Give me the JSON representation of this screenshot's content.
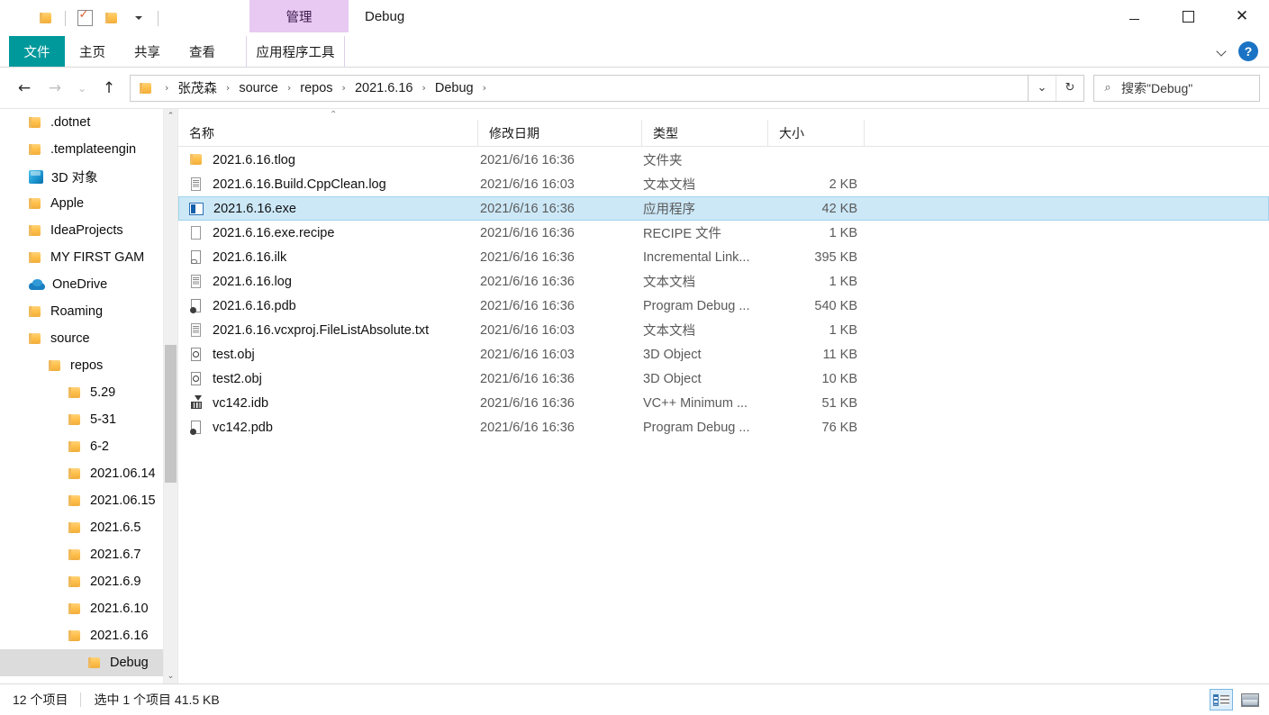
{
  "window": {
    "title": "Debug",
    "contextual_tab": "管理",
    "controls": {
      "minimize": "—",
      "maximize": "□",
      "close": "✕"
    }
  },
  "quick_access": {
    "items": [
      {
        "name": "folder-icon",
        "label": ""
      },
      {
        "name": "properties-icon",
        "label": ""
      },
      {
        "name": "new-folder-icon",
        "label": ""
      },
      {
        "name": "customize-dropdown-icon",
        "label": ""
      }
    ]
  },
  "ribbon": {
    "tabs": [
      {
        "id": "file",
        "label": "文件"
      },
      {
        "id": "home",
        "label": "主页"
      },
      {
        "id": "share",
        "label": "共享"
      },
      {
        "id": "view",
        "label": "查看"
      },
      {
        "id": "apptools",
        "label": "应用程序工具"
      }
    ],
    "expand_label": "",
    "help_label": "?"
  },
  "address": {
    "back": "←",
    "forward": "→",
    "recent": "⌄",
    "up": "↑",
    "crumbs": [
      "张茂森",
      "source",
      "repos",
      "2021.6.16",
      "Debug"
    ],
    "separator": "›",
    "dropdown": "⌄",
    "refresh": "↻"
  },
  "search": {
    "placeholder": "搜索\"Debug\"",
    "value": "",
    "icon": "search-icon"
  },
  "sidebar": {
    "items": [
      {
        "label": ".dotnet",
        "icon": "folder-icon",
        "indent": 0,
        "selected": false
      },
      {
        "label": ".templateengin",
        "icon": "folder-icon",
        "indent": 0,
        "selected": false
      },
      {
        "label": "3D 对象",
        "icon": "3d-objects-icon",
        "indent": 0,
        "selected": false
      },
      {
        "label": "Apple",
        "icon": "folder-icon",
        "indent": 0,
        "selected": false
      },
      {
        "label": "IdeaProjects",
        "icon": "folder-icon",
        "indent": 0,
        "selected": false
      },
      {
        "label": "MY FIRST GAM",
        "icon": "folder-icon",
        "indent": 0,
        "selected": false
      },
      {
        "label": "OneDrive",
        "icon": "onedrive-icon",
        "indent": 0,
        "selected": false
      },
      {
        "label": "Roaming",
        "icon": "folder-icon",
        "indent": 0,
        "selected": false
      },
      {
        "label": "source",
        "icon": "folder-icon",
        "indent": 0,
        "selected": false
      },
      {
        "label": "repos",
        "icon": "folder-icon",
        "indent": 1,
        "selected": false
      },
      {
        "label": "5.29",
        "icon": "folder-icon",
        "indent": 2,
        "selected": false
      },
      {
        "label": "5-31",
        "icon": "folder-icon",
        "indent": 2,
        "selected": false
      },
      {
        "label": "6-2",
        "icon": "folder-icon",
        "indent": 2,
        "selected": false
      },
      {
        "label": "2021.06.14",
        "icon": "folder-icon",
        "indent": 2,
        "selected": false
      },
      {
        "label": "2021.06.15",
        "icon": "folder-icon",
        "indent": 2,
        "selected": false
      },
      {
        "label": "2021.6.5",
        "icon": "folder-icon",
        "indent": 2,
        "selected": false
      },
      {
        "label": "2021.6.7",
        "icon": "folder-icon",
        "indent": 2,
        "selected": false
      },
      {
        "label": "2021.6.9",
        "icon": "folder-icon",
        "indent": 2,
        "selected": false
      },
      {
        "label": "2021.6.10",
        "icon": "folder-icon",
        "indent": 2,
        "selected": false
      },
      {
        "label": "2021.6.16",
        "icon": "folder-icon",
        "indent": 2,
        "selected": false
      },
      {
        "label": "Debug",
        "icon": "folder-icon",
        "indent": 3,
        "selected": true
      }
    ],
    "scroll_up": "⌃",
    "scroll_down": "⌄"
  },
  "filelist": {
    "sort_indicator": "⌃",
    "columns": [
      {
        "id": "name",
        "label": "名称"
      },
      {
        "id": "date",
        "label": "修改日期"
      },
      {
        "id": "type",
        "label": "类型"
      },
      {
        "id": "size",
        "label": "大小"
      }
    ],
    "rows": [
      {
        "name": "2021.6.16.tlog",
        "date": "2021/6/16 16:36",
        "type": "文件夹",
        "size": "",
        "icon": "folder",
        "selected": false
      },
      {
        "name": "2021.6.16.Build.CppClean.log",
        "date": "2021/6/16 16:03",
        "type": "文本文档",
        "size": "2 KB",
        "icon": "txt",
        "selected": false
      },
      {
        "name": "2021.6.16.exe",
        "date": "2021/6/16 16:36",
        "type": "应用程序",
        "size": "42 KB",
        "icon": "exe",
        "selected": true
      },
      {
        "name": "2021.6.16.exe.recipe",
        "date": "2021/6/16 16:36",
        "type": "RECIPE 文件",
        "size": "1 KB",
        "icon": "page",
        "selected": false
      },
      {
        "name": "2021.6.16.ilk",
        "date": "2021/6/16 16:36",
        "type": "Incremental Link...",
        "size": "395 KB",
        "icon": "ilk",
        "selected": false
      },
      {
        "name": "2021.6.16.log",
        "date": "2021/6/16 16:36",
        "type": "文本文档",
        "size": "1 KB",
        "icon": "txt",
        "selected": false
      },
      {
        "name": "2021.6.16.pdb",
        "date": "2021/6/16 16:36",
        "type": "Program Debug ...",
        "size": "540 KB",
        "icon": "pdb",
        "selected": false
      },
      {
        "name": "2021.6.16.vcxproj.FileListAbsolute.txt",
        "date": "2021/6/16 16:03",
        "type": "文本文档",
        "size": "1 KB",
        "icon": "txt",
        "selected": false
      },
      {
        "name": "test.obj",
        "date": "2021/6/16 16:03",
        "type": "3D Object",
        "size": "11 KB",
        "icon": "obj",
        "selected": false
      },
      {
        "name": "test2.obj",
        "date": "2021/6/16 16:36",
        "type": "3D Object",
        "size": "10 KB",
        "icon": "obj",
        "selected": false
      },
      {
        "name": "vc142.idb",
        "date": "2021/6/16 16:36",
        "type": "VC++ Minimum ...",
        "size": "51 KB",
        "icon": "idb",
        "selected": false
      },
      {
        "name": "vc142.pdb",
        "date": "2021/6/16 16:36",
        "type": "Program Debug ...",
        "size": "76 KB",
        "icon": "pdb",
        "selected": false
      }
    ]
  },
  "status": {
    "item_count": "12 个项目",
    "selection": "选中 1 个项目  41.5 KB",
    "view_details": "details-view",
    "view_large": "large-icons-view"
  }
}
